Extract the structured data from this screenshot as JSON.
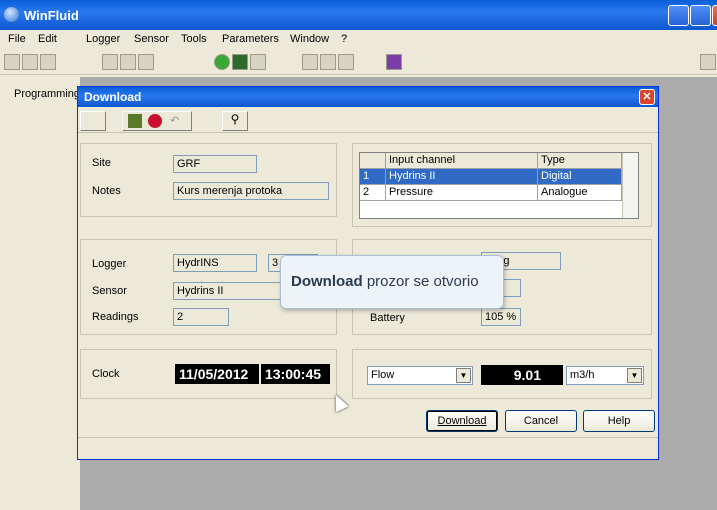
{
  "app": {
    "title": "WinFluid"
  },
  "menu": [
    "File",
    "Edit",
    "Logger",
    "Sensor",
    "Tools",
    "Parameters",
    "Window",
    "?"
  ],
  "side_tab": "Programming",
  "dialog": {
    "title": "Download",
    "site_label": "Site",
    "site_value": "GRF",
    "notes_label": "Notes",
    "notes_value": "Kurs merenja protoka",
    "channels": {
      "headers": [
        "",
        "Input channel",
        "Type"
      ],
      "rows": [
        {
          "n": "1",
          "channel": "Hydrins II",
          "type": "Digital"
        },
        {
          "n": "2",
          "channel": "Pressure",
          "type": "Analogue"
        }
      ]
    },
    "logger_label": "Logger",
    "logger_value": "HydrINS",
    "logger_extra": "3",
    "sensor_label": "Sensor",
    "sensor_value": "Hydrins II",
    "readings_label": "Readings",
    "readings_value": "2",
    "right_mid_value": "rding",
    "battery_label": "Battery",
    "battery_value": "105 %",
    "clock_label": "Clock",
    "clock_date": "11/05/2012",
    "clock_time": "13:00:45",
    "measure_select": "Flow",
    "measure_value": "9.01",
    "unit_select": "m3/h",
    "buttons": {
      "download": "Download",
      "cancel": "Cancel",
      "help": "Help"
    }
  },
  "tooltip": {
    "bold": "Download",
    "rest": " prozor se otvorio"
  },
  "colors": {
    "titlebar": "#0d56cf",
    "selection": "#316ac5",
    "dialog_bg": "#ece9d8"
  }
}
